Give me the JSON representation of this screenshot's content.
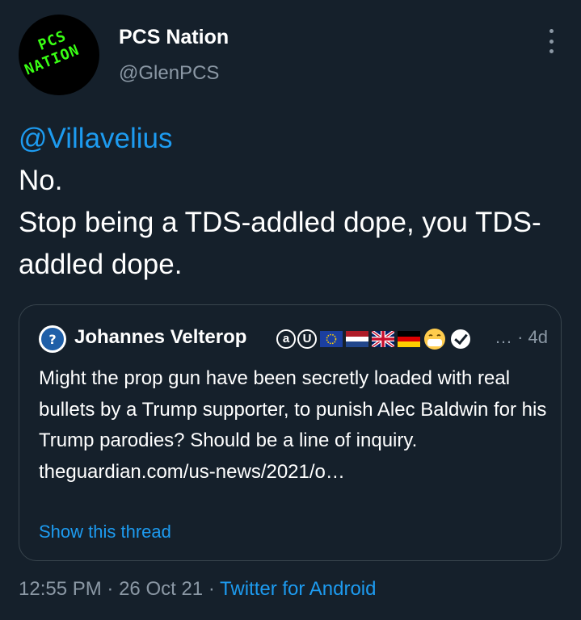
{
  "author": {
    "display_name": "PCS Nation",
    "handle": "@GlenPCS",
    "avatar_text_top": "PCS",
    "avatar_text_bottom": "NATION"
  },
  "tweet": {
    "mention": "@Villavelius",
    "line1": "No.",
    "line2": "Stop being a TDS-addled dope, you TDS-addled dope."
  },
  "quoted_tweet": {
    "display_name": "Johannes Velterop",
    "badge_a": "a",
    "badge_u": "U",
    "time": "… · 4d",
    "text": "Might the prop gun have been secretly loaded with real bullets by a Trump supporter, to punish Alec Baldwin for his Trump parodies? Should be a line of inquiry. theguardian.com/us-news/2021/o…",
    "show_thread": "Show this thread",
    "flags": [
      "eu-flag-icon",
      "netherlands-flag-icon",
      "uk-flag-icon",
      "germany-flag-icon",
      "mask-face-emoji-icon"
    ]
  },
  "footer": {
    "time": "12:55 PM",
    "date": "26 Oct 21",
    "separator": "·",
    "app": "Twitter for Android"
  },
  "colors": {
    "background": "#15202b",
    "accent": "#1d9bf0",
    "muted": "#8b98a5",
    "border": "#38444d"
  }
}
